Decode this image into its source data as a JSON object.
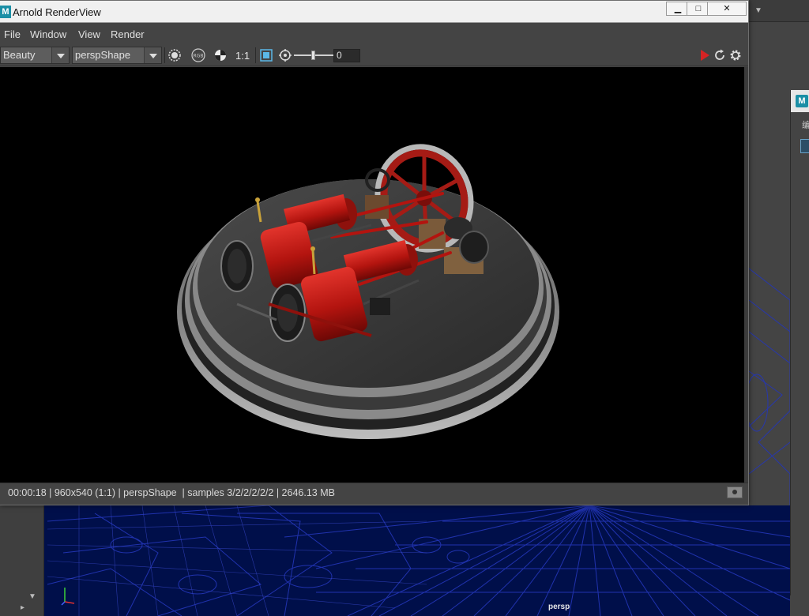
{
  "render_view": {
    "title": "Arnold RenderView",
    "window_controls": {
      "minimize": "▁",
      "maximize": "□",
      "close": "✕"
    },
    "menu": [
      "File",
      "Window",
      "View",
      "Render"
    ],
    "toolbar": {
      "aov": "Beauty",
      "camera": "perspShape",
      "ratio": "1:1",
      "exposure_value": "0",
      "icons": [
        "crop-region-icon",
        "rgb-channel-icon",
        "background-checker-icon",
        "storage-icon",
        "display-settings-icon",
        "render-play-icon",
        "refresh-icon",
        "settings-gear-icon"
      ],
      "render_accent": "#d62424"
    },
    "status": "00:00:18 | 960x540 (1:1) | perspShape  | samples 3/2/2/2/2/2 | 2646.13 MB"
  },
  "background_viewport": {
    "camera_label": "persp",
    "wireframe_color": "#1a2a8c",
    "side_window_badge": "M",
    "side_window_menu_glyph": "编"
  },
  "app_badge": "M"
}
